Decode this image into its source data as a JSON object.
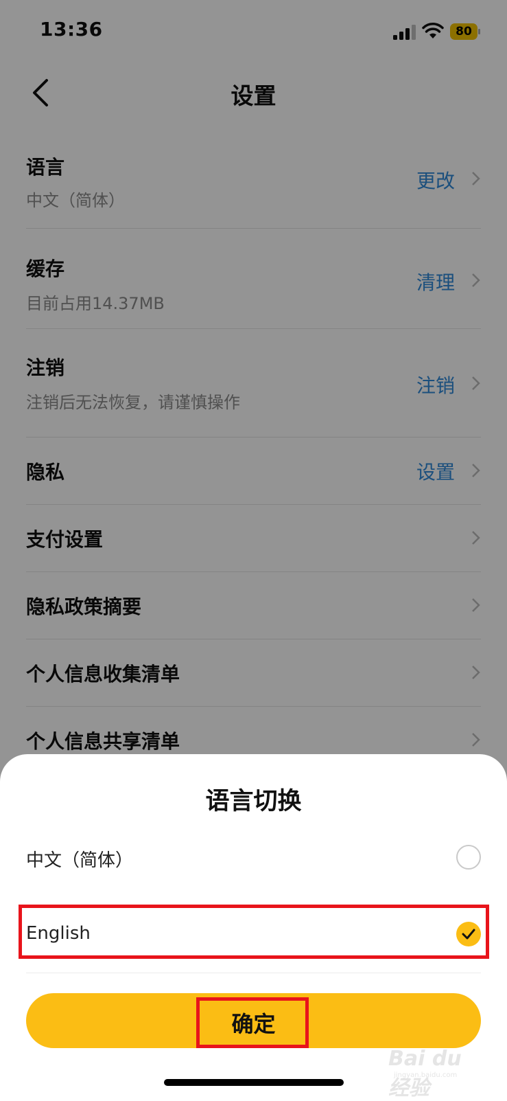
{
  "status_bar": {
    "time": "13:36",
    "battery": "80"
  },
  "nav": {
    "title": "设置"
  },
  "settings": [
    {
      "title": "语言",
      "subtitle": "中文（简体）",
      "action": "更改"
    },
    {
      "title": "缓存",
      "subtitle": "目前占用14.37MB",
      "action": "清理"
    },
    {
      "title": "注销",
      "subtitle": "注销后无法恢复，请谨慎操作",
      "action": "注销"
    },
    {
      "title": "隐私",
      "action": "设置"
    },
    {
      "title": "支付设置"
    },
    {
      "title": "隐私政策摘要"
    },
    {
      "title": "个人信息收集清单"
    },
    {
      "title": "个人信息共享清单"
    }
  ],
  "sheet": {
    "title": "语言切换",
    "options": [
      {
        "label": "中文（简体）",
        "selected": false
      },
      {
        "label": "English",
        "selected": true
      }
    ],
    "confirm_label": "确定"
  },
  "watermark": {
    "brand": "Bai du 经验",
    "url": "jingyan.baidu.com"
  },
  "colors": {
    "accent": "#fbbd14",
    "link": "#2f88d8",
    "highlight": "#e8141b",
    "overlay": "rgba(0,0,0,0.42)"
  },
  "icons": [
    "back-chevron-icon",
    "signal-icon",
    "wifi-icon",
    "battery-icon",
    "chevron-right-icon",
    "check-icon"
  ]
}
